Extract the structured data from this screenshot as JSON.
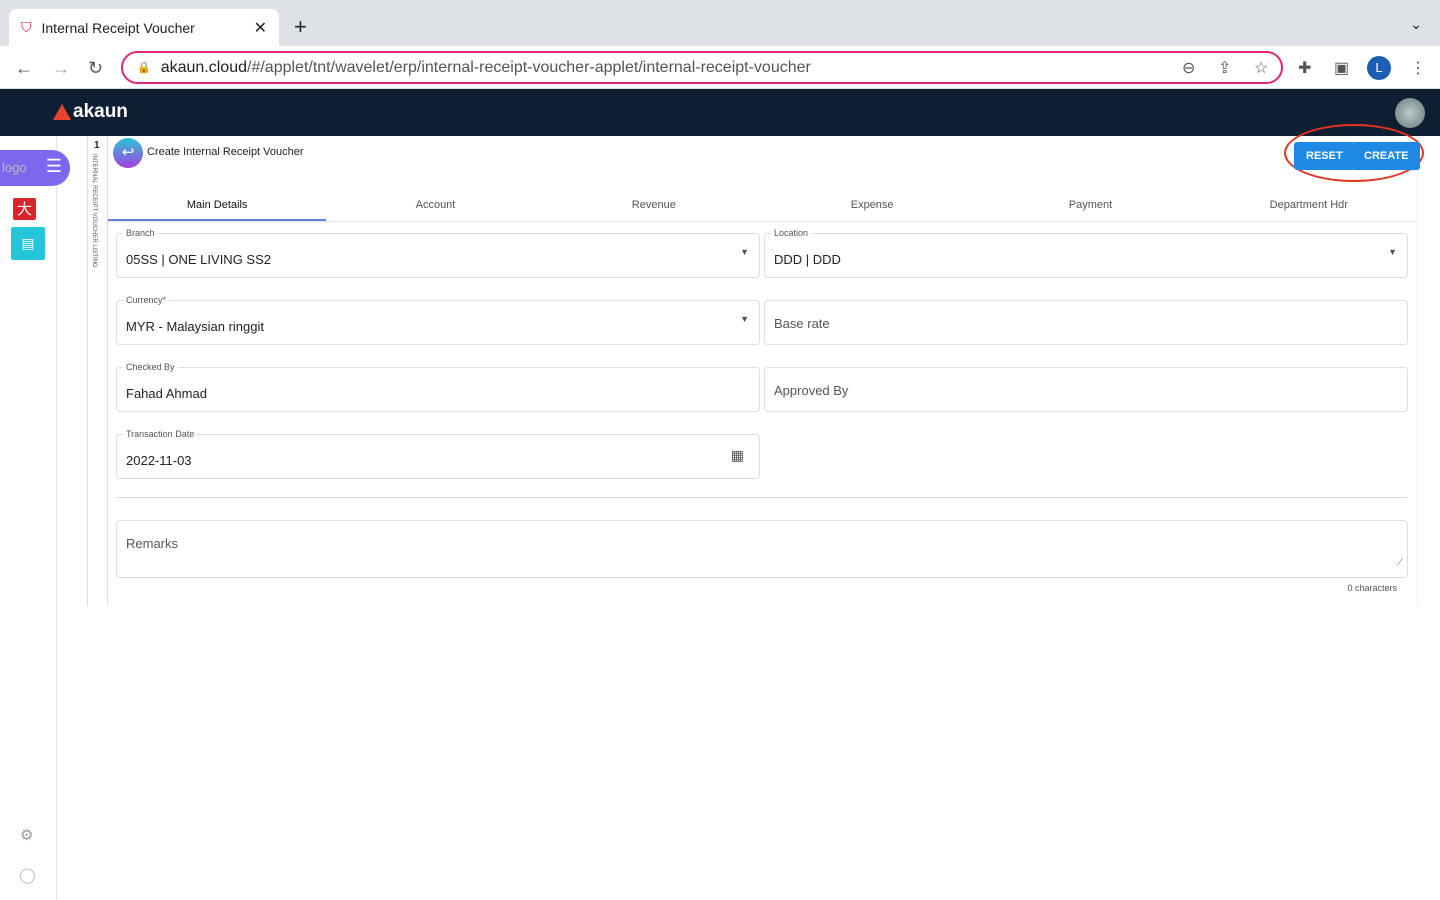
{
  "browser": {
    "tab_title": "Internal Receipt Voucher",
    "url_host": "akaun.cloud",
    "url_path": "/#/applet/tnt/wavelet/erp/internal-receipt-voucher-applet/internal-receipt-voucher",
    "profile_initial": "L"
  },
  "app": {
    "brand": "akaun"
  },
  "sidebar": {
    "logo_alt": "logo"
  },
  "strip": {
    "number": "1",
    "label": "INTERNAL RECEIPT VOUCHER LISTING"
  },
  "page": {
    "title": "Create Internal Receipt Voucher",
    "reset": "RESET",
    "create": "CREATE"
  },
  "tabs": [
    "Main Details",
    "Account",
    "Revenue",
    "Expense",
    "Payment",
    "Department Hdr"
  ],
  "form": {
    "branch": {
      "label": "Branch",
      "value": "05SS | ONE LIVING SS2"
    },
    "location": {
      "label": "Location",
      "value": "DDD | DDD"
    },
    "currency": {
      "label": "Currency*",
      "value": "MYR - Malaysian ringgit"
    },
    "base_rate": {
      "placeholder": "Base rate"
    },
    "checked_by": {
      "label": "Checked By",
      "value": "Fahad Ahmad"
    },
    "approved_by": {
      "placeholder": "Approved By"
    },
    "transaction_date": {
      "label": "Transaction Date",
      "value": "2022-11-03"
    },
    "remarks": {
      "placeholder": "Remarks",
      "counter": "0 characters"
    }
  }
}
